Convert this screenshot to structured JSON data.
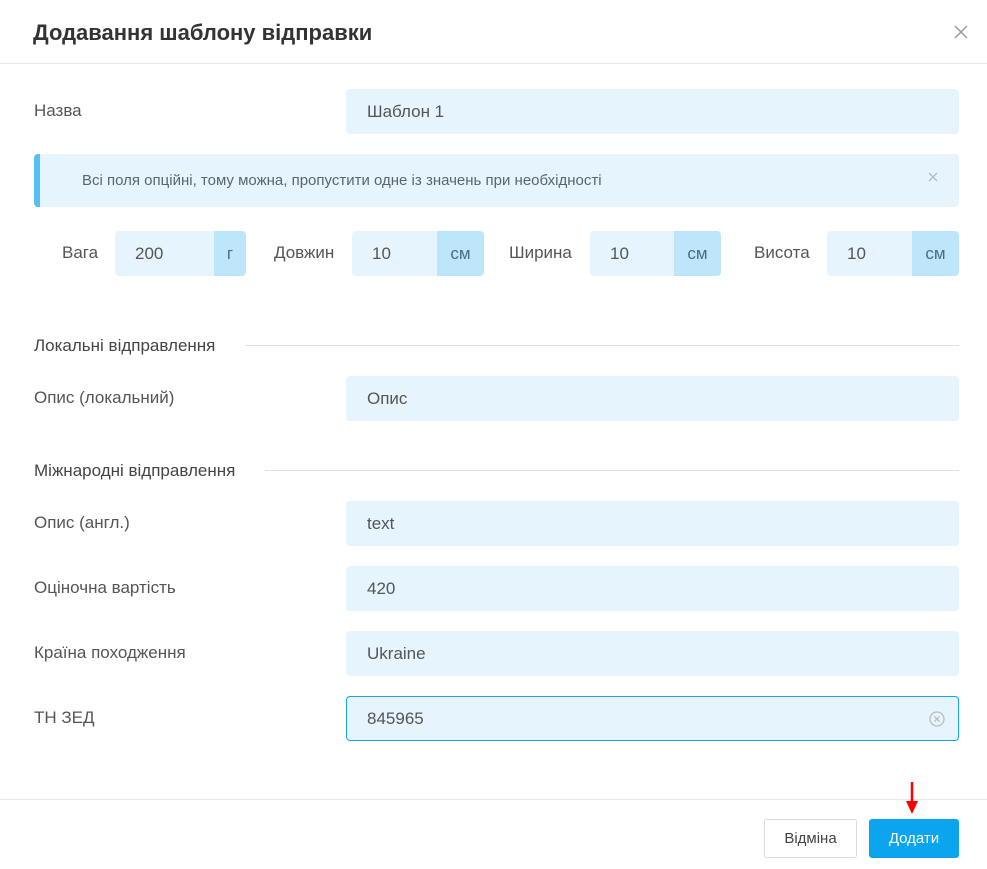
{
  "dialog": {
    "title": "Додавання шаблону відправки"
  },
  "name": {
    "label": "Назва",
    "value": "Шаблон 1"
  },
  "alert": {
    "text": "Всі поля опційні, тому можна, пропустити одне із значень при необхідності"
  },
  "dimensions": {
    "weight": {
      "label": "Вага",
      "value": "200",
      "unit": "г"
    },
    "length": {
      "label": "Довжин",
      "value": "10",
      "unit": "см"
    },
    "width": {
      "label": "Ширина",
      "value": "10",
      "unit": "см"
    },
    "height": {
      "label": "Висота",
      "value": "10",
      "unit": "см"
    }
  },
  "local": {
    "section_title": "Локальні відправлення",
    "description": {
      "label": "Опис (локальний)",
      "value": "Опис"
    }
  },
  "international": {
    "section_title": "Міжнародні відправлення",
    "description": {
      "label": "Опис (англ.)",
      "value": "text"
    },
    "value_estimate": {
      "label": "Оціночна вартість",
      "value": "420"
    },
    "country": {
      "label": "Країна походження",
      "value": "Ukraine"
    },
    "hs_code": {
      "label": "ТН ЗЕД",
      "value": "845965"
    }
  },
  "footer": {
    "cancel_label": "Відміна",
    "add_label": "Додати"
  },
  "colors": {
    "field_bg": "#e6f5fd",
    "accent": "#0ba5ef",
    "arrow": "#ff0000"
  }
}
